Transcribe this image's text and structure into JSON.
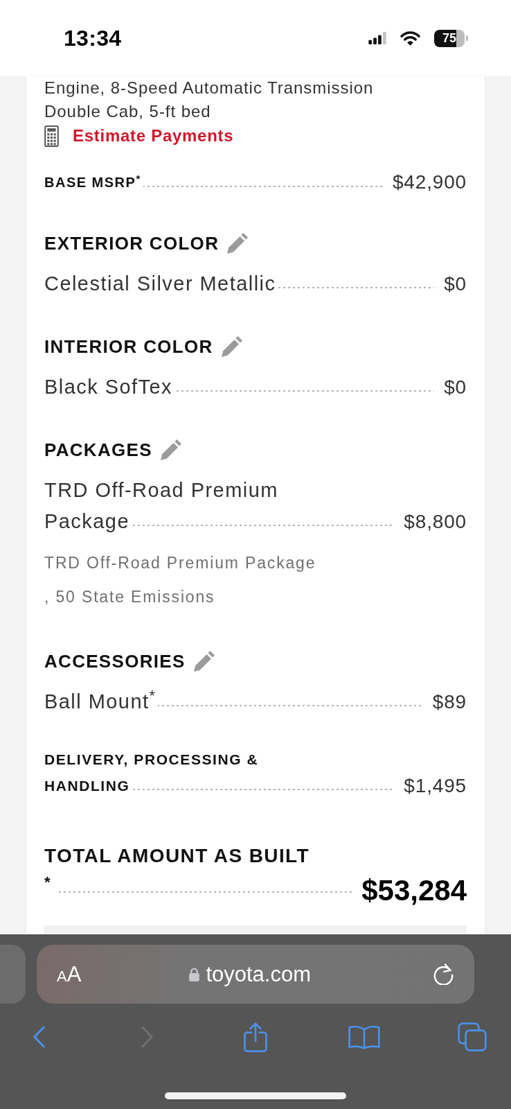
{
  "status_bar": {
    "time": "13:34",
    "battery": "75"
  },
  "vehicle": {
    "details": [
      "Engine, 8-Speed Automatic Transmission",
      "Double Cab, 5-ft bed"
    ],
    "estimate_link": "Estimate Payments"
  },
  "base_msrp": {
    "label": "BASE MSRP$^{*}$",
    "price": "$42,900"
  },
  "sections": [
    {
      "title": "EXTERIOR COLOR",
      "editable": true,
      "items": [
        {
          "name": "Celestial Silver Metallic",
          "price": "$0"
        }
      ]
    },
    {
      "title": "INTERIOR COLOR",
      "editable": true,
      "items": [
        {
          "name": "Black SofTex",
          "price": "$0"
        }
      ]
    },
    {
      "title": "PACKAGES",
      "editable": true,
      "items": [
        {
          "name": "TRD Off-Road Premium Package",
          "price": "$8,800",
          "description": "TRD Off-Road Premium Package\n, 50 State Emissions"
        }
      ]
    },
    {
      "title": "ACCESSORIES",
      "editable": true,
      "items": [
        {
          "name": "Ball Mount$^{*}$",
          "price": "$89"
        }
      ]
    }
  ],
  "delivery": {
    "label": "DELIVERY, PROCESSING & HANDLING",
    "price": "$1,495"
  },
  "total": {
    "label": "TOTAL AMOUNT AS BUILT",
    "footnote_mark": "*",
    "price": "$53,284"
  },
  "browser": {
    "text_size_button": "AA",
    "url": "toyota.com",
    "toolbar": [
      {
        "kind": "back",
        "disabled": false
      },
      {
        "kind": "forward",
        "disabled": true
      },
      {
        "kind": "share",
        "disabled": false
      },
      {
        "kind": "bookmarks",
        "disabled": false
      },
      {
        "kind": "tabs",
        "disabled": false
      }
    ]
  }
}
